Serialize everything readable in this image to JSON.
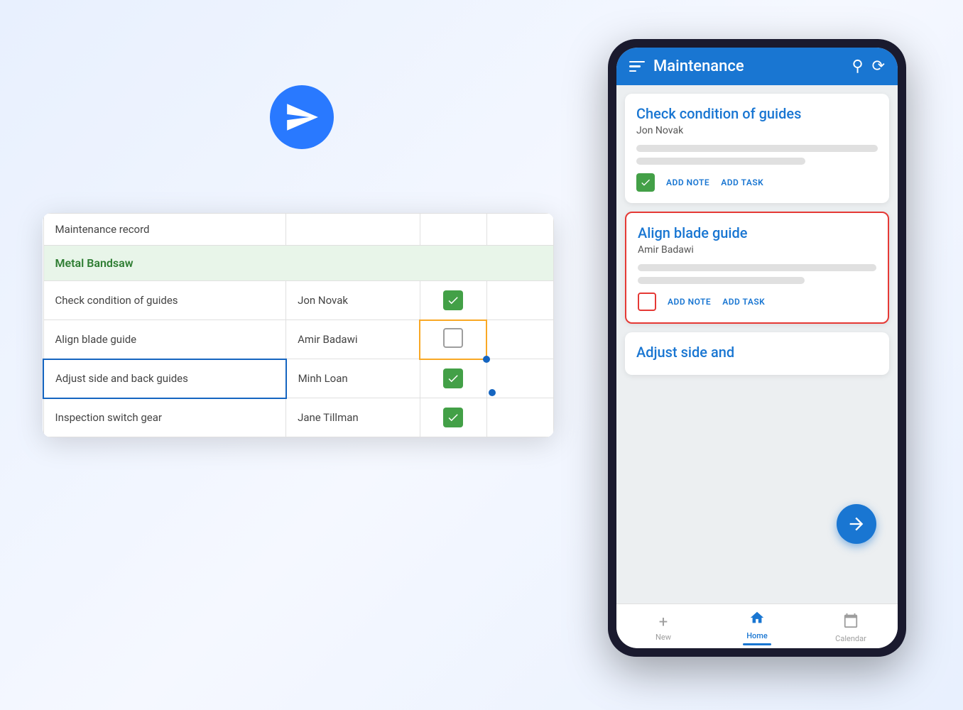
{
  "app": {
    "title": "Maintenance"
  },
  "paper_plane": {
    "alt": "paper plane icon"
  },
  "spreadsheet": {
    "header_label": "Maintenance record",
    "section_label": "Metal Bandsaw",
    "rows": [
      {
        "task": "Check condition of guides",
        "person": "Jon Novak",
        "checked": true,
        "selected": false,
        "yellow_border": false
      },
      {
        "task": "Align blade guide",
        "person": "Amir Badawi",
        "checked": false,
        "selected": false,
        "yellow_border": true
      },
      {
        "task": "Adjust side and back guides",
        "person": "Minh Loan",
        "checked": true,
        "selected": true,
        "yellow_border": false
      },
      {
        "task": "Inspection switch gear",
        "person": "Jane Tillman",
        "checked": true,
        "selected": false,
        "yellow_border": false
      }
    ]
  },
  "mobile_cards": [
    {
      "id": "card1",
      "title": "Check condition of guides",
      "subtitle": "Jon Novak",
      "checked": true,
      "check_type": "green",
      "actions": [
        "ADD NOTE",
        "ADD TASK"
      ],
      "border": "none"
    },
    {
      "id": "card2",
      "title": "Align blade guide",
      "subtitle": "Amir Badawi",
      "checked": false,
      "check_type": "red",
      "actions": [
        "ADD NOTE",
        "ADD TASK"
      ],
      "border": "red"
    },
    {
      "id": "card3",
      "title": "Adjust side and",
      "subtitle": "",
      "partial": true
    }
  ],
  "bottom_nav": {
    "items": [
      {
        "id": "new",
        "label": "New",
        "icon": "plus",
        "active": false
      },
      {
        "id": "home",
        "label": "Home",
        "icon": "home",
        "active": true
      },
      {
        "id": "calendar",
        "label": "Calendar",
        "icon": "calendar",
        "active": false
      }
    ]
  },
  "labels": {
    "add_note": "ADD NOTE",
    "add_task": "ADD TASK"
  }
}
